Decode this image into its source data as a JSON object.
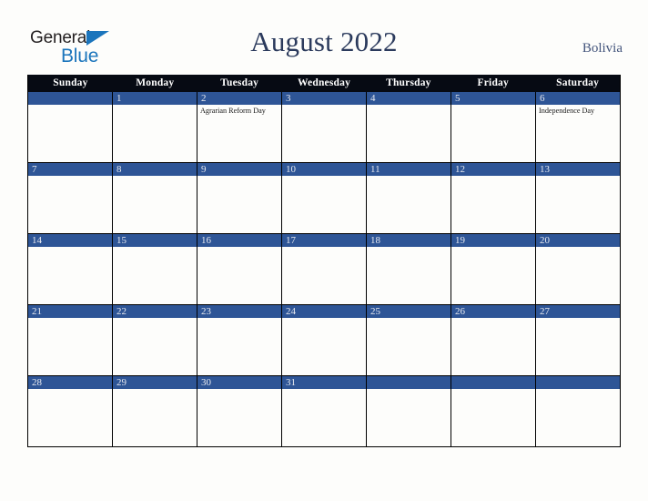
{
  "logo": {
    "word_top": "General",
    "word_bottom": "Blue",
    "triangle_color": "#1b75bc",
    "text_color": "#231f20"
  },
  "header": {
    "title": "August 2022",
    "region": "Bolivia",
    "title_color": "#2b3a5c",
    "region_color": "#44557c"
  },
  "calendar": {
    "band_color": "#2e5596",
    "header_bg": "#060a13",
    "header_text_color": "#ffffff",
    "day_names": [
      "Sunday",
      "Monday",
      "Tuesday",
      "Wednesday",
      "Thursday",
      "Friday",
      "Saturday"
    ],
    "weeks": [
      [
        {
          "num": "",
          "events": []
        },
        {
          "num": "1",
          "events": []
        },
        {
          "num": "2",
          "events": [
            "Agrarian Reform Day"
          ]
        },
        {
          "num": "3",
          "events": []
        },
        {
          "num": "4",
          "events": []
        },
        {
          "num": "5",
          "events": []
        },
        {
          "num": "6",
          "events": [
            "Independence Day"
          ]
        }
      ],
      [
        {
          "num": "7",
          "events": []
        },
        {
          "num": "8",
          "events": []
        },
        {
          "num": "9",
          "events": []
        },
        {
          "num": "10",
          "events": []
        },
        {
          "num": "11",
          "events": []
        },
        {
          "num": "12",
          "events": []
        },
        {
          "num": "13",
          "events": []
        }
      ],
      [
        {
          "num": "14",
          "events": []
        },
        {
          "num": "15",
          "events": []
        },
        {
          "num": "16",
          "events": []
        },
        {
          "num": "17",
          "events": []
        },
        {
          "num": "18",
          "events": []
        },
        {
          "num": "19",
          "events": []
        },
        {
          "num": "20",
          "events": []
        }
      ],
      [
        {
          "num": "21",
          "events": []
        },
        {
          "num": "22",
          "events": []
        },
        {
          "num": "23",
          "events": []
        },
        {
          "num": "24",
          "events": []
        },
        {
          "num": "25",
          "events": []
        },
        {
          "num": "26",
          "events": []
        },
        {
          "num": "27",
          "events": []
        }
      ],
      [
        {
          "num": "28",
          "events": []
        },
        {
          "num": "29",
          "events": []
        },
        {
          "num": "30",
          "events": []
        },
        {
          "num": "31",
          "events": []
        },
        {
          "num": "",
          "events": []
        },
        {
          "num": "",
          "events": []
        },
        {
          "num": "",
          "events": []
        }
      ]
    ]
  }
}
